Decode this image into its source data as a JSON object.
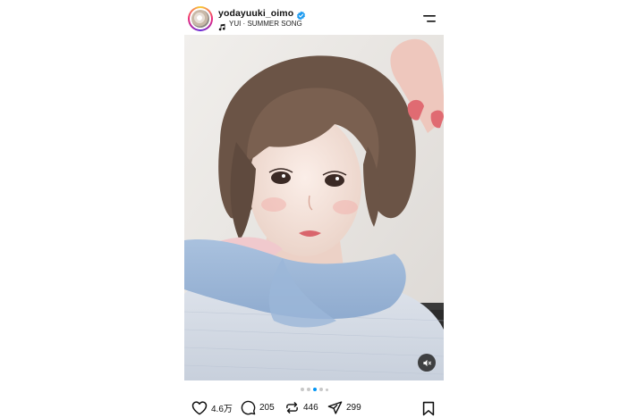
{
  "post": {
    "username": "yodayuuki_oimo",
    "music": "YUI · SUMMER SONG",
    "carousel": {
      "total": 5,
      "active_index": 2
    }
  },
  "actions": {
    "likes": "4.6万",
    "comments": "205",
    "reposts": "446",
    "shares": "299"
  },
  "icons": [
    "verified-badge-icon",
    "music-note-icon",
    "menu-icon",
    "mute-icon",
    "heart-icon",
    "comment-icon",
    "repost-icon",
    "share-icon",
    "bookmark-icon"
  ],
  "colors": {
    "verified": "#1d9bf0",
    "active_dot": "#0095f6",
    "inactive_dot": "#c7c7c7"
  }
}
